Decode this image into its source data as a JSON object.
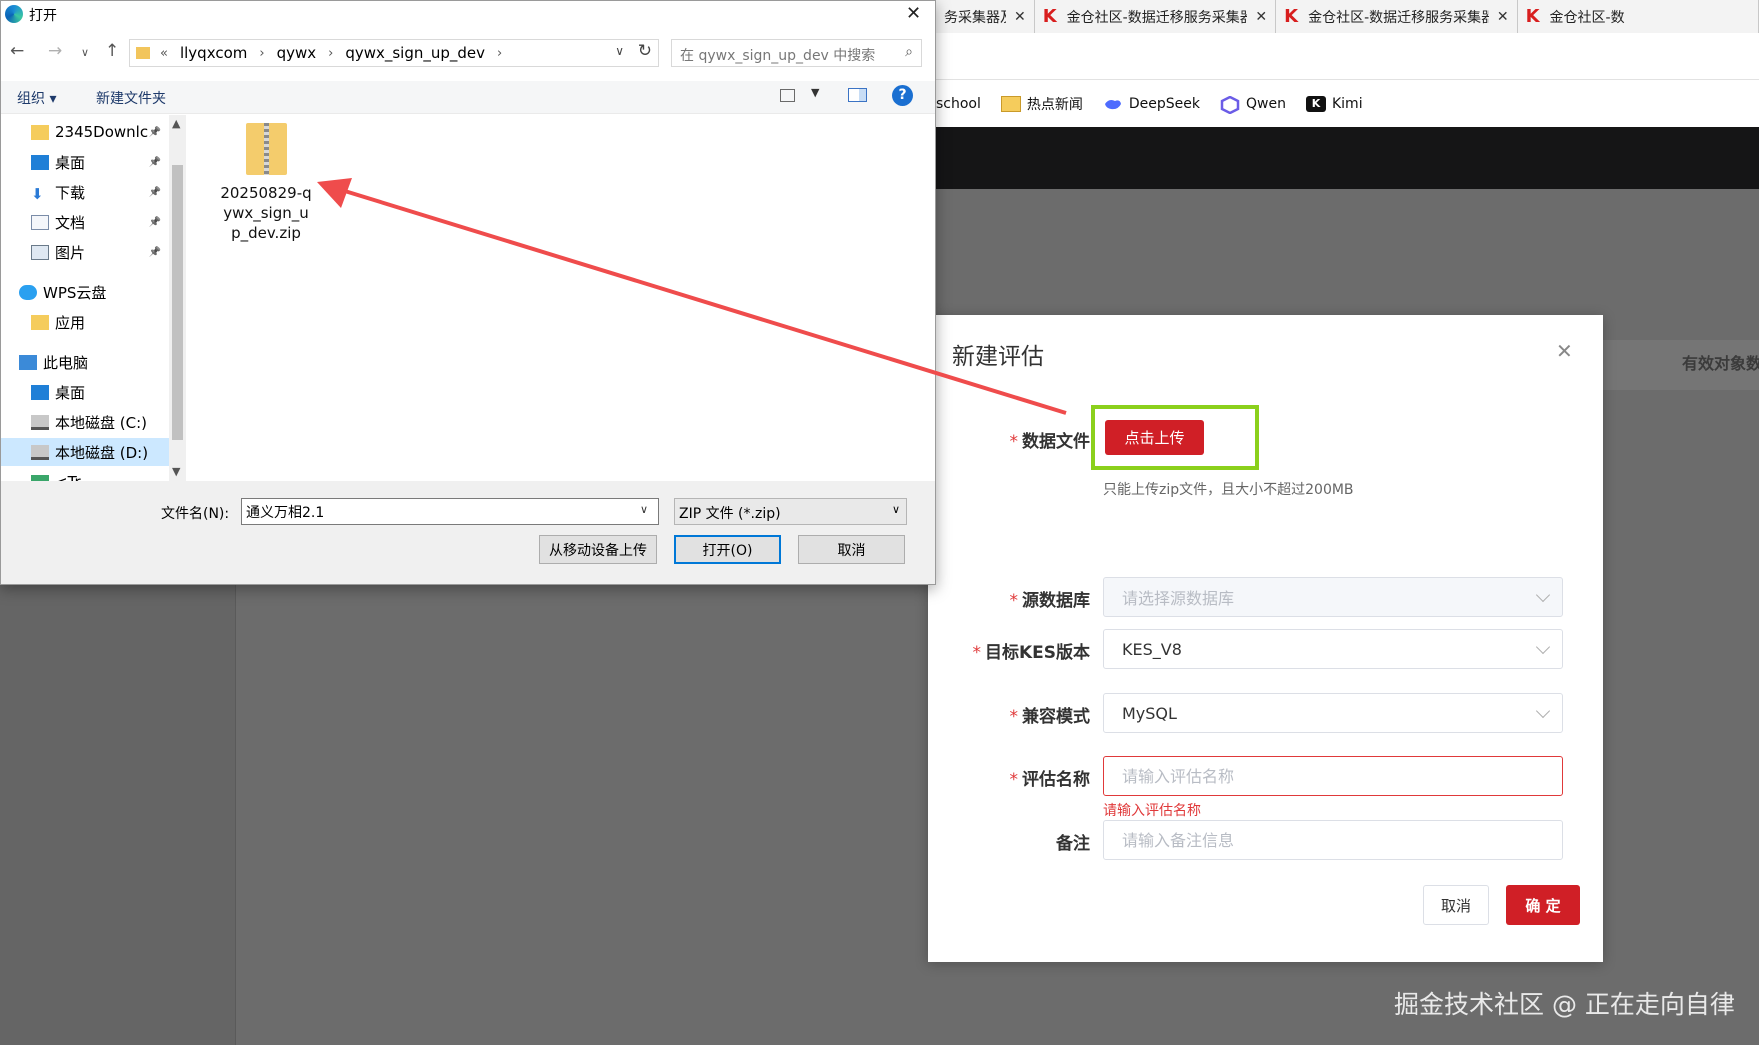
{
  "browser": {
    "tabs": [
      {
        "title": "务采集器及F",
        "closable": true
      },
      {
        "title": "金仓社区-数据迁移服务采集器及F",
        "closable": true
      },
      {
        "title": "金仓社区-数据迁移服务采集器及F",
        "closable": true
      },
      {
        "title": "金仓社区-数",
        "closable": false
      }
    ],
    "bookmarks": [
      "school",
      "热点新闻",
      "DeepSeek",
      "Qwen",
      "Kimi"
    ],
    "side_column_label": "有效对象数"
  },
  "dialog": {
    "title": "打开",
    "path": [
      "llyqxcom",
      "qywx",
      "qywx_sign_up_dev"
    ],
    "path_prefix": "«",
    "search_placeholder": "在 qywx_sign_up_dev 中搜索",
    "toolbar": {
      "organize": "组织 ▾",
      "new_folder": "新建文件夹"
    },
    "nav_items": [
      {
        "label": "2345Downlc",
        "icon": "folder-icon",
        "pinned": true,
        "selected": false
      },
      {
        "label": "桌面",
        "icon": "desktop-icon",
        "pinned": true,
        "selected": false
      },
      {
        "label": "下载",
        "icon": "download-icon",
        "pinned": true,
        "selected": false
      },
      {
        "label": "文档",
        "icon": "document-icon",
        "pinned": true,
        "selected": false
      },
      {
        "label": "图片",
        "icon": "picture-icon",
        "pinned": true,
        "selected": false
      },
      {
        "label": "WPS云盘",
        "icon": "cloud-icon",
        "pinned": false,
        "selected": false
      },
      {
        "label": "应用",
        "icon": "folder-icon",
        "pinned": false,
        "selected": false
      },
      {
        "label": "此电脑",
        "icon": "computer-icon",
        "pinned": false,
        "selected": false
      },
      {
        "label": "桌面",
        "icon": "desktop-icon",
        "pinned": false,
        "selected": false
      },
      {
        "label": "本地磁盘 (C:)",
        "icon": "drive-icon",
        "pinned": false,
        "selected": false
      },
      {
        "label": "本地磁盘 (D:)",
        "icon": "drive-icon",
        "pinned": false,
        "selected": true
      },
      {
        "label": "<Tr...",
        "icon": "network-icon",
        "pinned": false,
        "selected": false
      }
    ],
    "file": {
      "name": "20250829-qywx_sign_up_dev.zip",
      "icon": "zip-file-icon"
    },
    "filename_label": "文件名(N):",
    "filename_value": "通义万相2.1",
    "filetype": "ZIP 文件 (*.zip)",
    "buttons": {
      "mobile_upload": "从移动设备上传",
      "open": "打开(O)",
      "cancel": "取消"
    }
  },
  "modal": {
    "title": "新建评估",
    "fields": {
      "data_file": {
        "label": "数据文件",
        "required": true,
        "button": "点击上传",
        "hint": "只能上传zip文件，且大小不超过200MB"
      },
      "source_db": {
        "label": "源数据库",
        "required": true,
        "placeholder": "请选择源数据库",
        "disabled": true
      },
      "kes_version": {
        "label": "目标KES版本",
        "required": true,
        "value": "KES_V8"
      },
      "compat_mode": {
        "label": "兼容模式",
        "required": true,
        "value": "MySQL"
      },
      "eval_name": {
        "label": "评估名称",
        "required": true,
        "placeholder": "请输入评估名称",
        "error": "请输入评估名称"
      },
      "remark": {
        "label": "备注",
        "required": false,
        "placeholder": "请输入备注信息"
      }
    },
    "buttons": {
      "cancel": "取消",
      "confirm": "确 定"
    }
  },
  "watermark": "掘金技术社区 @ 正在走向自律",
  "colors": {
    "accent_red": "#d01f26",
    "highlight_green": "#8bd01c",
    "arrow_red": "#ef4c4c",
    "error_red": "#e0393a"
  }
}
